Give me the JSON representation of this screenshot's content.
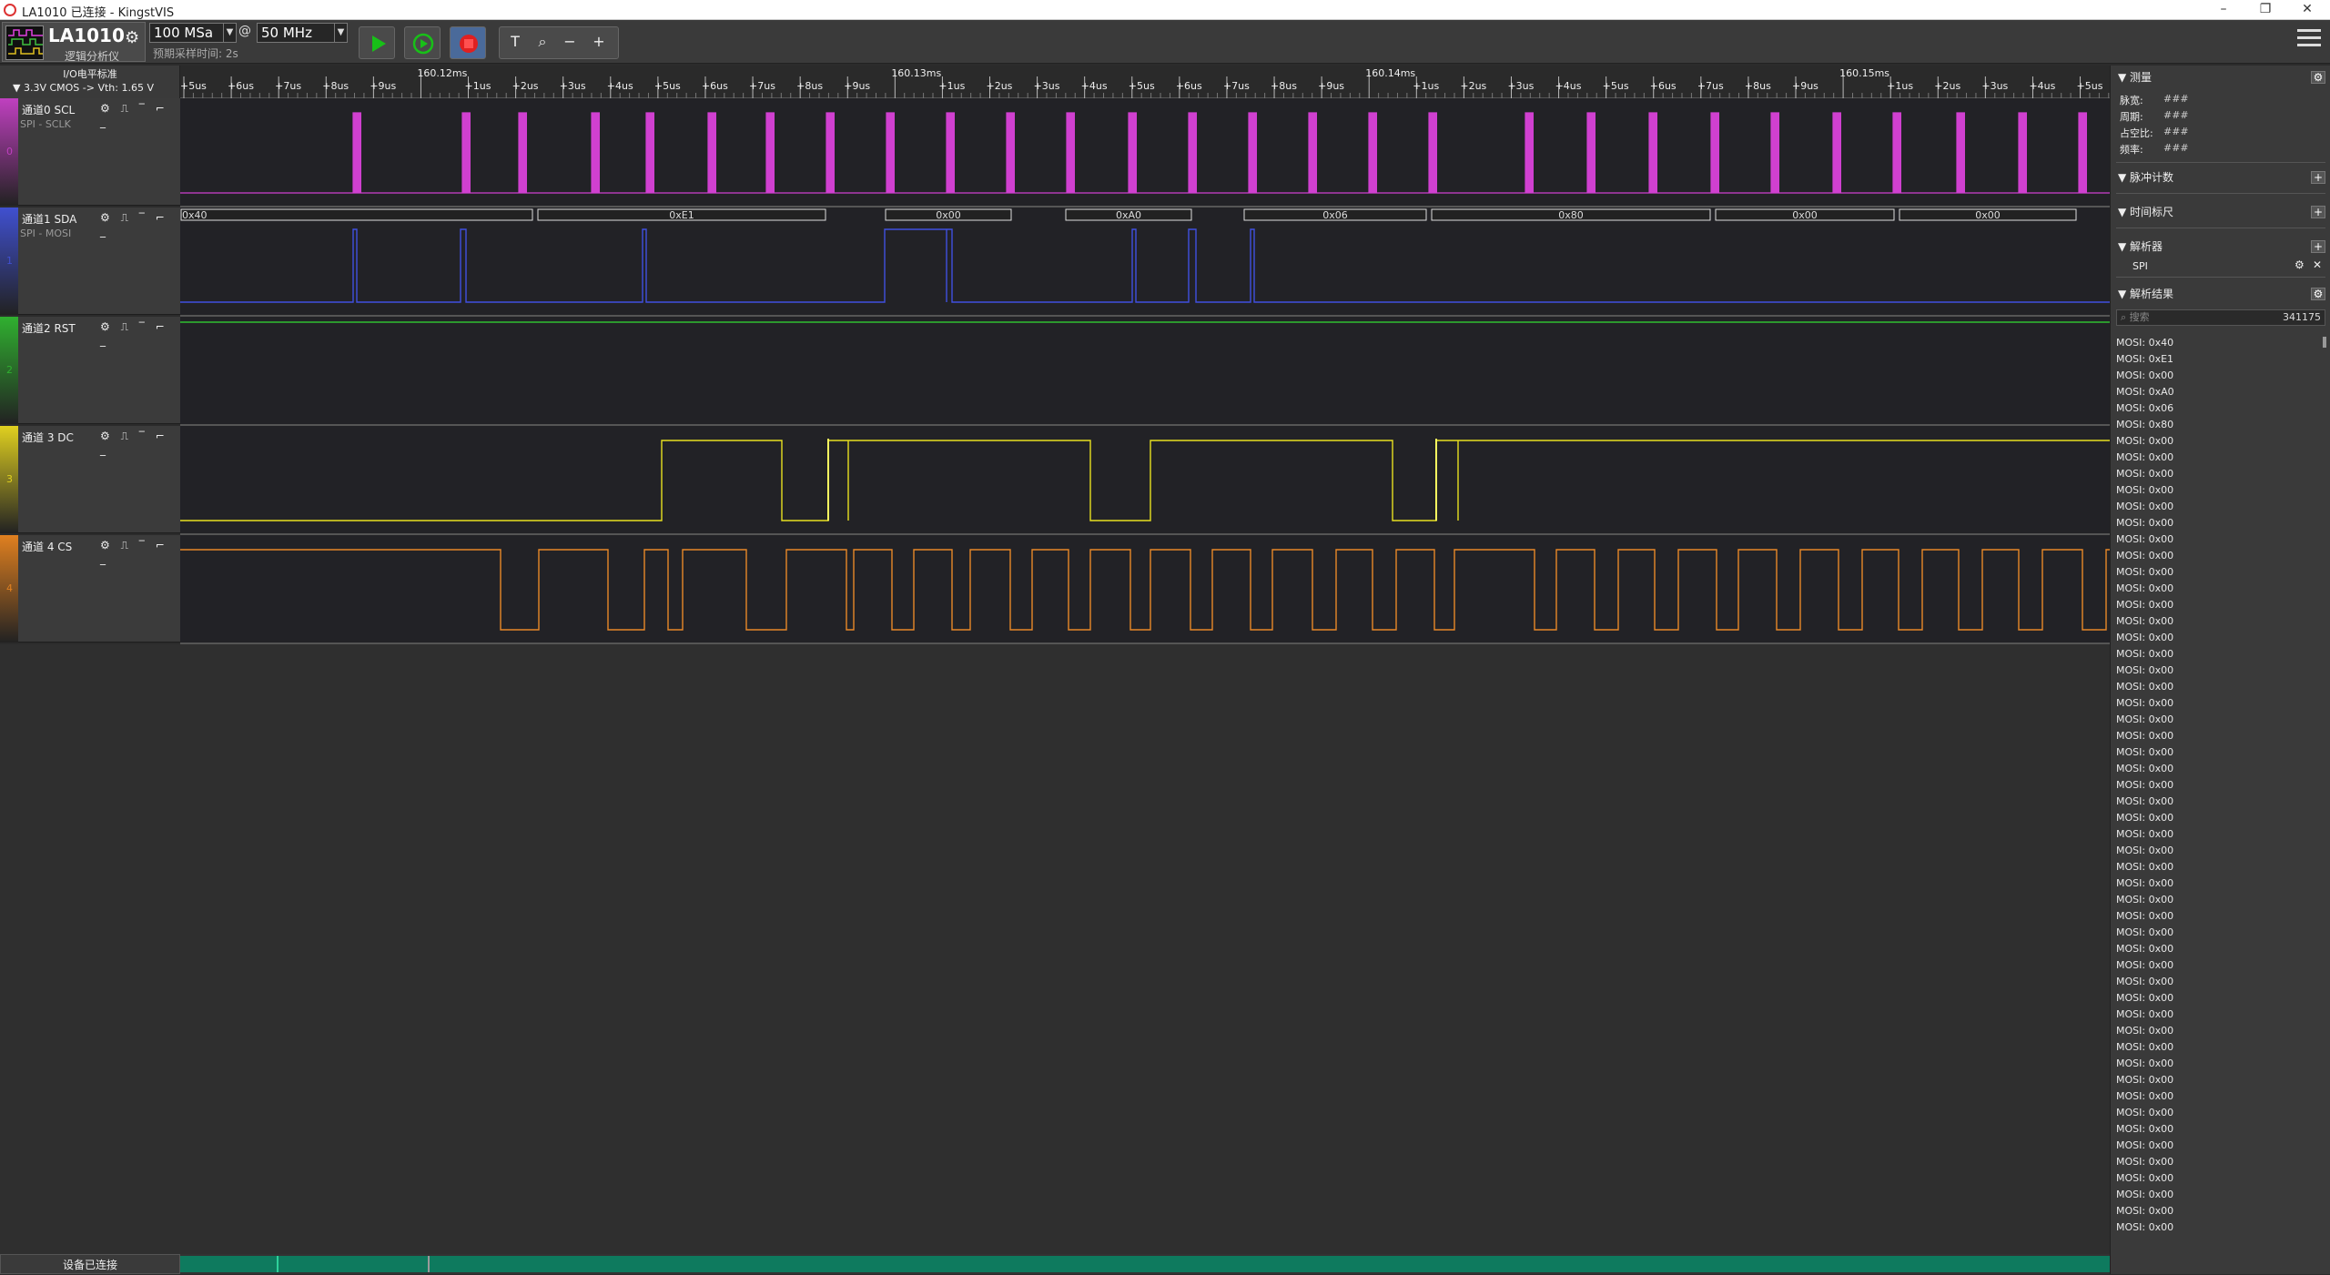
{
  "window": {
    "title": "LA1010 已连接 - KingstVIS",
    "controls": [
      "–",
      "❐",
      "✕"
    ]
  },
  "toolbar": {
    "device_name": "LA1010",
    "device_subtitle": "逻辑分析仪",
    "sample_depth": "100 MSa",
    "at": "@",
    "sample_rate": "50 MHz",
    "expected_time": "预期采样时间: 2s",
    "buttons": {
      "start": "start-icon",
      "loop": "loop-icon",
      "stop": "stop-icon"
    },
    "tools": [
      "T",
      "⌕",
      "−",
      "+"
    ]
  },
  "io_standard": {
    "label": "I/O电平标准",
    "value": "▼  3.3V CMOS  -> Vth: 1.65 V"
  },
  "ruler": {
    "labels": [
      "+5us",
      "+6us",
      "+7us",
      "+8us",
      "+9us",
      "160.12ms",
      "+1us",
      "+2us",
      "+3us",
      "+4us",
      "+5us",
      "+6us",
      "+7us",
      "+8us",
      "+9us",
      "160.13ms",
      "+1us",
      "+2us",
      "+3us",
      "+4us",
      "+5us",
      "+6us",
      "+7us",
      "+8us",
      "+9us",
      "160.14ms",
      "+1us",
      "+2us",
      "+3us",
      "+4us",
      "+5us",
      "+6us",
      "+7us",
      "+8us",
      "+9us",
      "160.15ms",
      "+1us",
      "+2us",
      "+3us",
      "+4us",
      "+5us"
    ]
  },
  "channels": [
    {
      "index": "0",
      "name": "通道0 SCL",
      "protocol": "SPI - SCLK",
      "color": "#c040c0"
    },
    {
      "index": "1",
      "name": "通道1 SDA",
      "protocol": "SPI - MOSI",
      "color": "#4050d0"
    },
    {
      "index": "2",
      "name": "通道2 RST",
      "protocol": "",
      "color": "#30b030"
    },
    {
      "index": "3",
      "name": "通道 3 DC",
      "protocol": "",
      "color": "#e0d020"
    },
    {
      "index": "4",
      "name": "通道 4 CS",
      "protocol": "",
      "color": "#e08020"
    }
  ],
  "decode_labels": [
    "0x40",
    "0xE1",
    "0x00",
    "0xA0",
    "0x06",
    "0x80",
    "0x00",
    "0x00"
  ],
  "right_panel": {
    "measure_title": "测量",
    "measurements": [
      {
        "label": "脉宽:",
        "value": "###"
      },
      {
        "label": "周期:",
        "value": "###"
      },
      {
        "label": "占空比:",
        "value": "###"
      },
      {
        "label": "频率:",
        "value": "###"
      }
    ],
    "pulse_count_title": "脉冲计数",
    "time_marker_title": "时间标尺",
    "analyzer_title": "解析器",
    "analyzer_item": "SPI",
    "results_title": "解析结果",
    "search_placeholder": "搜索",
    "result_count": "341175",
    "results": [
      "MOSI: 0x40",
      "MOSI: 0xE1",
      "MOSI: 0x00",
      "MOSI: 0xA0",
      "MOSI: 0x06",
      "MOSI: 0x80",
      "MOSI: 0x00",
      "MOSI: 0x00",
      "MOSI: 0x00",
      "MOSI: 0x00",
      "MOSI: 0x00",
      "MOSI: 0x00",
      "MOSI: 0x00",
      "MOSI: 0x00",
      "MOSI: 0x00",
      "MOSI: 0x00",
      "MOSI: 0x00",
      "MOSI: 0x00",
      "MOSI: 0x00",
      "MOSI: 0x00",
      "MOSI: 0x00",
      "MOSI: 0x00",
      "MOSI: 0x00",
      "MOSI: 0x00",
      "MOSI: 0x00",
      "MOSI: 0x00",
      "MOSI: 0x00",
      "MOSI: 0x00",
      "MOSI: 0x00",
      "MOSI: 0x00",
      "MOSI: 0x00",
      "MOSI: 0x00",
      "MOSI: 0x00",
      "MOSI: 0x00",
      "MOSI: 0x00",
      "MOSI: 0x00",
      "MOSI: 0x00",
      "MOSI: 0x00",
      "MOSI: 0x00",
      "MOSI: 0x00",
      "MOSI: 0x00",
      "MOSI: 0x00",
      "MOSI: 0x00",
      "MOSI: 0x00",
      "MOSI: 0x00",
      "MOSI: 0x00",
      "MOSI: 0x00",
      "MOSI: 0x00",
      "MOSI: 0x00",
      "MOSI: 0x00",
      "MOSI: 0x00",
      "MOSI: 0x00",
      "MOSI: 0x00",
      "MOSI: 0x00",
      "MOSI: 0x00"
    ]
  },
  "status": {
    "label": "设备已连接"
  }
}
